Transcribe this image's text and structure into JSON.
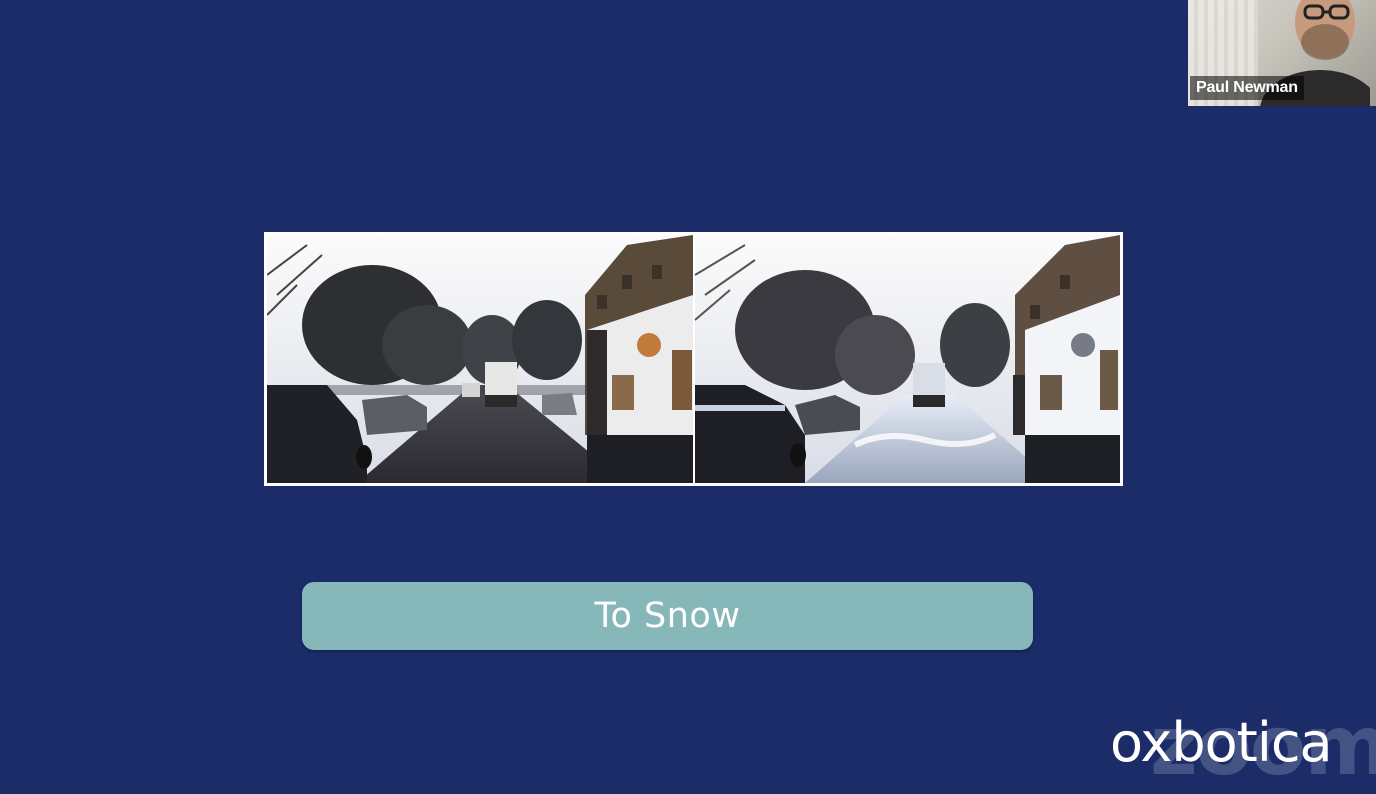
{
  "meeting": {
    "speaker_name": "Paul Newman",
    "app_watermark": "zoom"
  },
  "slide": {
    "caption": "To Snow",
    "brand": "oxbotica",
    "images": [
      {
        "name": "original-street-scene",
        "condition": "clear"
      },
      {
        "name": "translated-street-scene",
        "condition": "snow"
      }
    ]
  },
  "colors": {
    "background": "#1b2c69",
    "caption_bar": "#86b7b9",
    "caption_text": "#ffffff",
    "brand_text": "#ffffff"
  }
}
